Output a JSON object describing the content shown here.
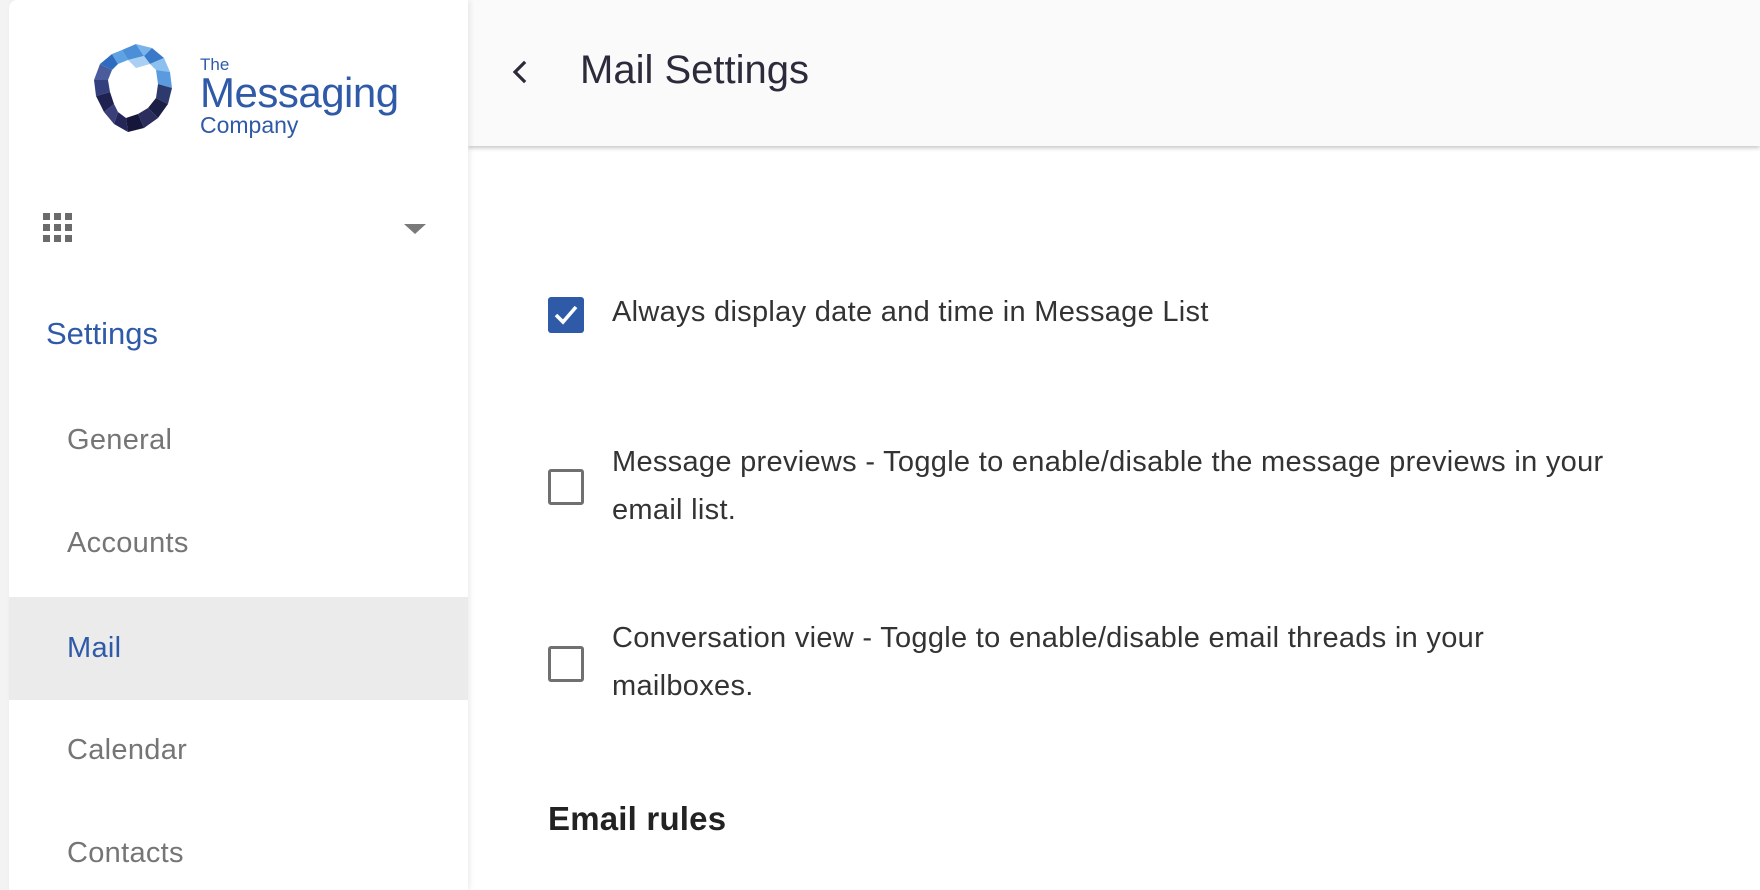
{
  "brand": {
    "line1": "The",
    "line2": "Messaging",
    "line3": "Company"
  },
  "sidebar": {
    "heading": "Settings",
    "items": [
      {
        "label": "General",
        "active": false
      },
      {
        "label": "Accounts",
        "active": false
      },
      {
        "label": "Mail",
        "active": true
      },
      {
        "label": "Calendar",
        "active": false
      },
      {
        "label": "Contacts",
        "active": false
      }
    ]
  },
  "header": {
    "title": "Mail Settings"
  },
  "main": {
    "options": [
      {
        "label": "Always display date and time in Message List",
        "checked": true
      },
      {
        "label": "Message previews - Toggle to enable/disable the message previews in your email list.",
        "checked": false
      },
      {
        "label": "Conversation view - Toggle to enable/disable email threads in your mailboxes.",
        "checked": false
      }
    ],
    "section_heading": "Email rules"
  },
  "colors": {
    "accent": "#2f5aa8",
    "active_bg": "#ebebeb"
  }
}
